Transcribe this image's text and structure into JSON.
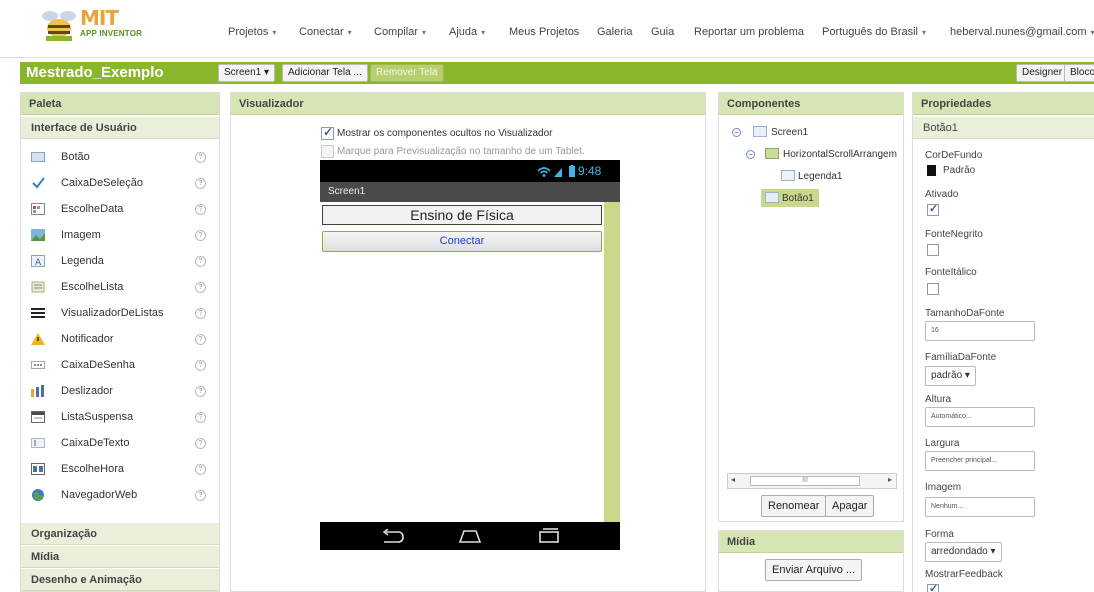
{
  "nav": {
    "logo_title": "MIT",
    "logo_subtitle": "APP INVENTOR",
    "items": [
      {
        "label": "Projetos",
        "caret": "▾"
      },
      {
        "label": "Conectar",
        "caret": "▾"
      },
      {
        "label": "Compilar",
        "caret": "▾"
      },
      {
        "label": "Ajuda",
        "caret": "▾"
      },
      {
        "label": "Meus Projetos"
      },
      {
        "label": "Galeria"
      },
      {
        "label": "Guia"
      },
      {
        "label": "Reportar um problema"
      },
      {
        "label": "Português do Brasil",
        "caret": "▾"
      },
      {
        "label": "heberval.nunes@gmail.com",
        "caret": "▾"
      }
    ]
  },
  "project": {
    "name": "Mestrado_Exemplo",
    "screen_select": "Screen1 ▾",
    "add_screen": "Adicionar Tela ...",
    "remove_screen": "Remover Tela",
    "designer": "Designer",
    "blocks": "Blocos"
  },
  "palette": {
    "title": "Paleta",
    "section": "Interface de Usuário",
    "items": [
      {
        "label": "Botão",
        "icon": "button-icon"
      },
      {
        "label": "CaixaDeSeleção",
        "icon": "checkbox-icon"
      },
      {
        "label": "EscolheData",
        "icon": "datepicker-icon"
      },
      {
        "label": "Imagem",
        "icon": "image-icon"
      },
      {
        "label": "Legenda",
        "icon": "label-icon"
      },
      {
        "label": "EscolheLista",
        "icon": "listpicker-icon"
      },
      {
        "label": "VisualizadorDeListas",
        "icon": "listview-icon"
      },
      {
        "label": "Notificador",
        "icon": "notifier-icon"
      },
      {
        "label": "CaixaDeSenha",
        "icon": "passwordbox-icon"
      },
      {
        "label": "Deslizador",
        "icon": "slider-icon"
      },
      {
        "label": "ListaSuspensa",
        "icon": "spinner-icon"
      },
      {
        "label": "CaixaDeTexto",
        "icon": "textbox-icon"
      },
      {
        "label": "EscolheHora",
        "icon": "timepicker-icon"
      },
      {
        "label": "NavegadorWeb",
        "icon": "webviewer-icon"
      }
    ],
    "help_glyph": "?",
    "other_sections": [
      "Organização",
      "Mídia",
      "Desenho e Animação"
    ]
  },
  "viewer": {
    "title": "Visualizador",
    "show_hidden": "Mostrar os componentes ocultos no Visualizador",
    "tablet_preview": "Marque para Previsualização no tamanho de um Tablet.",
    "status_time": "9:48",
    "screen_title": "Screen1",
    "label_text": "Ensino de Física",
    "button_text": "Conectar"
  },
  "components": {
    "title": "Componentes",
    "tree": {
      "screen": "Screen1",
      "arrangement": "HorizontalScrollArrangem",
      "label": "Legenda1",
      "button": "Botão1"
    },
    "scroll_glyph": "III",
    "rename": "Renomear",
    "delete": "Apagar"
  },
  "media": {
    "title": "Mídia",
    "upload": "Enviar Arquivo ..."
  },
  "properties": {
    "title": "Propriedades",
    "component": "Botão1",
    "bg_color_label": "CorDeFundo",
    "bg_color_value": "Padrão",
    "enabled_label": "Ativado",
    "bold_label": "FonteNegrito",
    "italic_label": "FonteItálico",
    "font_size_label": "TamanhoDaFonte",
    "font_size_value": "16",
    "font_family_label": "FamíliaDaFonte",
    "font_family_value": "padrão ▾",
    "height_label": "Altura",
    "height_value": "Automático...",
    "width_label": "Largura",
    "width_value": "Preencher principal...",
    "image_label": "Imagem",
    "image_value": "Nenhum...",
    "shape_label": "Forma",
    "shape_value": "arredondado ▾",
    "feedback_label": "MostrarFeedback"
  },
  "colors": {
    "accent_green": "#8ab62c",
    "panel_header": "#d7e5b4",
    "phone_highlight": "#c8d98b"
  }
}
